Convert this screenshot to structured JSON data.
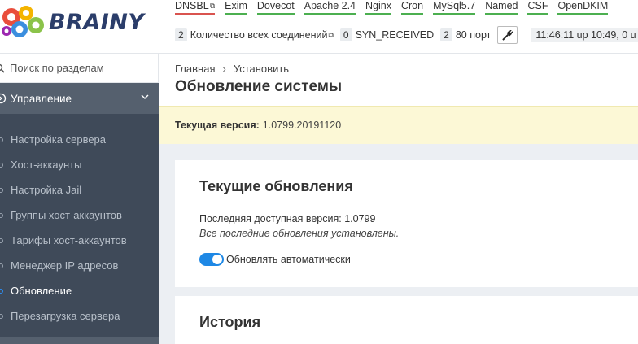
{
  "brand": {
    "name": "BRAINY"
  },
  "header": {
    "services": [
      {
        "label": "DNSBL",
        "status": "error",
        "external": true
      },
      {
        "label": "Exim",
        "status": "ok"
      },
      {
        "label": "Dovecot",
        "status": "ok"
      },
      {
        "label": "Apache 2.4",
        "status": "ok"
      },
      {
        "label": "Nginx",
        "status": "ok"
      },
      {
        "label": "Cron",
        "status": "ok"
      },
      {
        "label": "MySql5.7",
        "status": "ok"
      },
      {
        "label": "Named",
        "status": "ok"
      },
      {
        "label": "CSF",
        "status": "ok"
      },
      {
        "label": "OpenDKIM",
        "status": "ok"
      }
    ],
    "stats": {
      "connections_count": "2",
      "connections_label": "Количество всех соединений",
      "syn_count": "0",
      "syn_label": "SYN_RECEIVED",
      "port_count": "2",
      "port_label": "80 порт",
      "uptime": "11:46:11 up 10:49, 0 u"
    },
    "icons": {
      "plug": "plug-icon",
      "external": "external-link-icon"
    }
  },
  "sidebar": {
    "search_placeholder": "Поиск по разделам",
    "section_label": "Управление",
    "items": [
      {
        "label": "Настройка сервера"
      },
      {
        "label": "Хост-аккаунты"
      },
      {
        "label": "Настройка Jail"
      },
      {
        "label": "Группы хост-аккаунтов"
      },
      {
        "label": "Тарифы хост-аккаунтов"
      },
      {
        "label": "Менеджер IP адресов"
      },
      {
        "label": "Обновление",
        "active": true
      },
      {
        "label": "Перезагрузка сервера"
      }
    ]
  },
  "main": {
    "breadcrumb": {
      "home": "Главная",
      "current": "Установить"
    },
    "title": "Обновление системы",
    "version_label": "Текущая версия:",
    "version_value": "1.0799.20191120",
    "current_updates": {
      "title": "Текущие обновления",
      "latest_label": "Последняя доступная версия: 1.0799",
      "status_text": "Все последние обновления установлены.",
      "auto_update_label": "Обновлять автоматически",
      "auto_update_on": true
    },
    "history": {
      "title": "История"
    }
  },
  "colors": {
    "accent": "#1e88e5",
    "ok": "#4caf50",
    "error": "#d9534f",
    "sidebar": "#3f4a59"
  }
}
